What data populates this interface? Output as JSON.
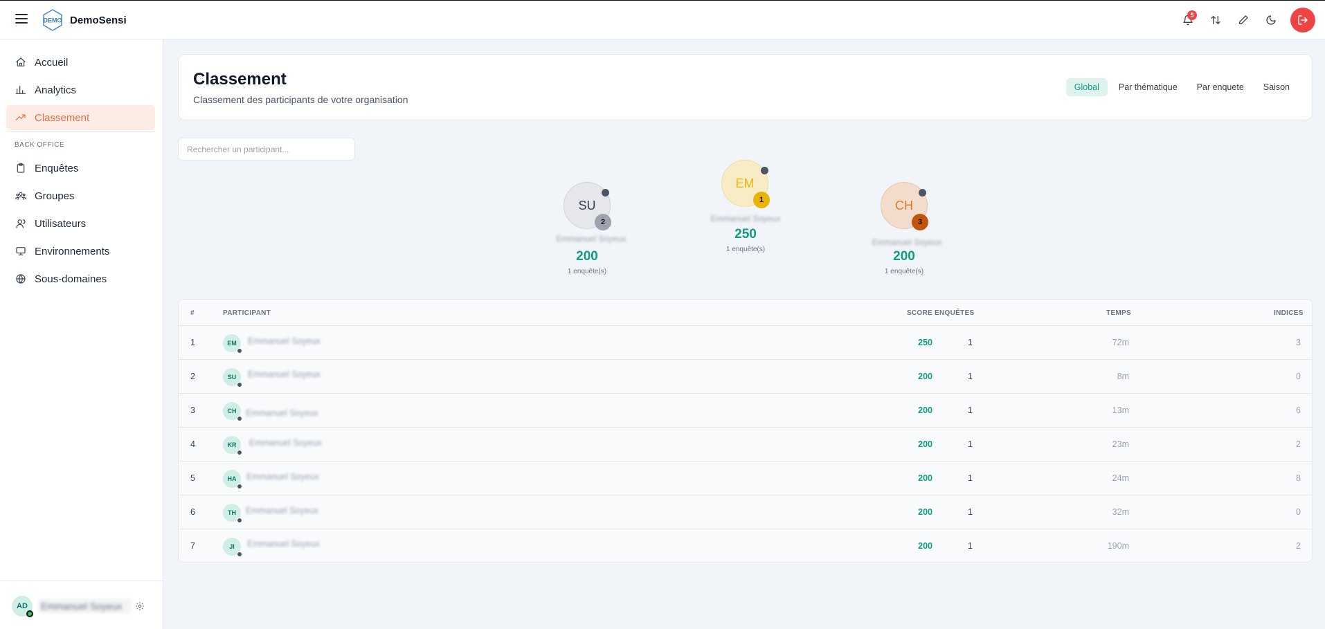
{
  "app": {
    "brand": "DemoSensi",
    "logo_text": "DEMO",
    "notifications_count": "5"
  },
  "header_icons": [
    "bell-icon",
    "swap-icon",
    "pencil-icon",
    "moon-icon",
    "logout-icon"
  ],
  "sidebar": {
    "items": [
      {
        "label": "Accueil",
        "icon": "home-icon"
      },
      {
        "label": "Analytics",
        "icon": "bar-chart-icon"
      },
      {
        "label": "Classement",
        "icon": "trending-icon",
        "active": true
      }
    ],
    "section_label": "BACK OFFICE",
    "back_office": [
      {
        "label": "Enquêtes",
        "icon": "clipboard-icon"
      },
      {
        "label": "Groupes",
        "icon": "groups-icon"
      },
      {
        "label": "Utilisateurs",
        "icon": "users-icon"
      },
      {
        "label": "Environnements",
        "icon": "monitor-icon"
      },
      {
        "label": "Sous-domaines",
        "icon": "globe-icon"
      }
    ],
    "footer": {
      "initials": "AD",
      "name": "Emmanuel Soyeux"
    }
  },
  "page": {
    "title": "Classement",
    "subtitle": "Classement des participants de votre organisation",
    "tabs": [
      "Global",
      "Par thématique",
      "Par enquete",
      "Saison"
    ],
    "active_tab": "Global"
  },
  "search": {
    "placeholder": "Rechercher un participant..."
  },
  "podium": [
    {
      "initials": "SU",
      "rank": "2",
      "name": "Emmanuel Soyeux",
      "score": "200",
      "count": "1 enquête(s)",
      "bg": "#e5e7eb",
      "text": "#374151",
      "rank_bg": "#9ca3af"
    },
    {
      "initials": "EM",
      "rank": "1",
      "name": "Emmanuel Soyeux",
      "score": "250",
      "count": "1 enquête(s)",
      "bg": "#f7ecc6",
      "text": "#eab308",
      "rank_bg": "#eab308"
    },
    {
      "initials": "CH",
      "rank": "3",
      "name": "Emmanuel Soyeux",
      "score": "200",
      "count": "1 enquête(s)",
      "bg": "#f2dccb",
      "text": "#e07b2a",
      "rank_bg": "#c2540f"
    }
  ],
  "table": {
    "headers": {
      "rank": "#",
      "participant": "PARTICIPANT",
      "score": "SCORE",
      "surveys": "ENQUÊTES",
      "time": "TEMPS",
      "hints": "INDICES"
    },
    "rows": [
      {
        "rank": "1",
        "initials": "EM",
        "name": "Emmanuel Soyeux",
        "score": "250",
        "surveys": "1",
        "time": "72m",
        "hints": "3"
      },
      {
        "rank": "2",
        "initials": "SU",
        "name": "Emmanuel Soyeux",
        "score": "200",
        "surveys": "1",
        "time": "8m",
        "hints": "0"
      },
      {
        "rank": "3",
        "initials": "CH",
        "name": "Emmanuel Soyeux",
        "score": "200",
        "surveys": "1",
        "time": "13m",
        "hints": "6"
      },
      {
        "rank": "4",
        "initials": "KR",
        "name": "Emmanuel Soyeux",
        "score": "200",
        "surveys": "1",
        "time": "23m",
        "hints": "2"
      },
      {
        "rank": "5",
        "initials": "HA",
        "name": "Emmanuel Soyeux",
        "score": "200",
        "surveys": "1",
        "time": "24m",
        "hints": "8"
      },
      {
        "rank": "6",
        "initials": "TH",
        "name": "Emmanuel Soyeux",
        "score": "200",
        "surveys": "1",
        "time": "32m",
        "hints": "0"
      },
      {
        "rank": "7",
        "initials": "JI",
        "name": "Emmanuel Soyeux",
        "score": "200",
        "surveys": "1",
        "time": "190m",
        "hints": "2"
      }
    ]
  },
  "colors": {
    "accent": "#0f9c7f",
    "active_nav": "#e76b43",
    "danger": "#ef4444"
  }
}
